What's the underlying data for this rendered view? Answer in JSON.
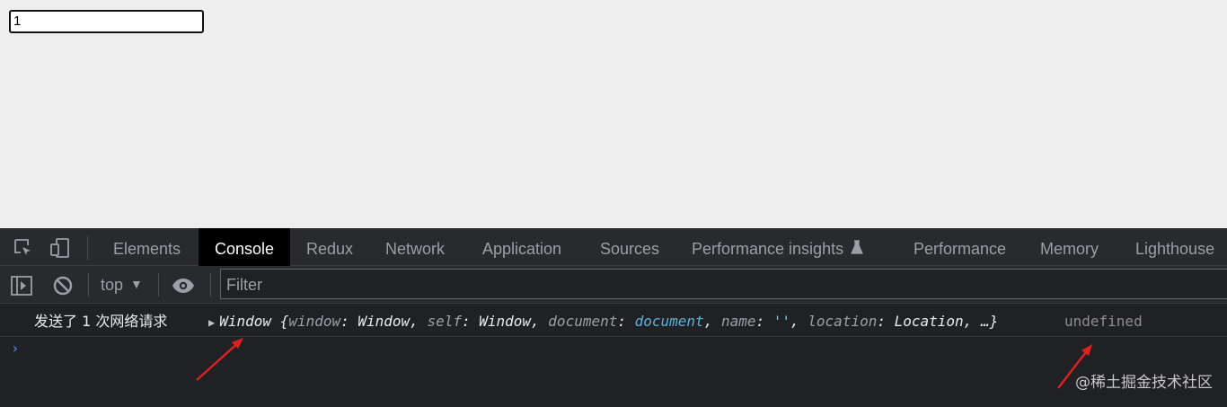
{
  "page": {
    "input_value": "1"
  },
  "devtools": {
    "tabs": [
      {
        "label": "Elements",
        "active": false
      },
      {
        "label": "Console",
        "active": true
      },
      {
        "label": "Redux",
        "active": false
      },
      {
        "label": "Network",
        "active": false
      },
      {
        "label": "Application",
        "active": false
      },
      {
        "label": "Sources",
        "active": false
      },
      {
        "label": "Performance insights",
        "active": false,
        "icon": "flask-icon"
      },
      {
        "label": "Performance",
        "active": false
      },
      {
        "label": "Memory",
        "active": false
      },
      {
        "label": "Lighthouse",
        "active": false
      }
    ],
    "toolbar": {
      "context": "top",
      "filter_placeholder": "Filter"
    },
    "console": {
      "log_message": "发送了 1 次网络请求",
      "object_preview": {
        "class_name": "Window",
        "open_brace": "{",
        "entries": [
          {
            "key": "window",
            "value": "Window",
            "type": "object"
          },
          {
            "key": "self",
            "value": "Window",
            "type": "object"
          },
          {
            "key": "document",
            "value": "document",
            "type": "link"
          },
          {
            "key": "name",
            "value": "''",
            "type": "string"
          },
          {
            "key": "location",
            "value": "Location",
            "type": "object"
          }
        ],
        "ellipsis": "…}"
      },
      "return_value": "undefined",
      "prompt_symbol": "›"
    }
  },
  "watermark": "@稀土掘金技术社区",
  "colors": {
    "annotation_arrow": "#e02020",
    "active_tab_bg": "#000000",
    "string_value": "#5cd5fb",
    "prompt": "#4d90fe"
  }
}
